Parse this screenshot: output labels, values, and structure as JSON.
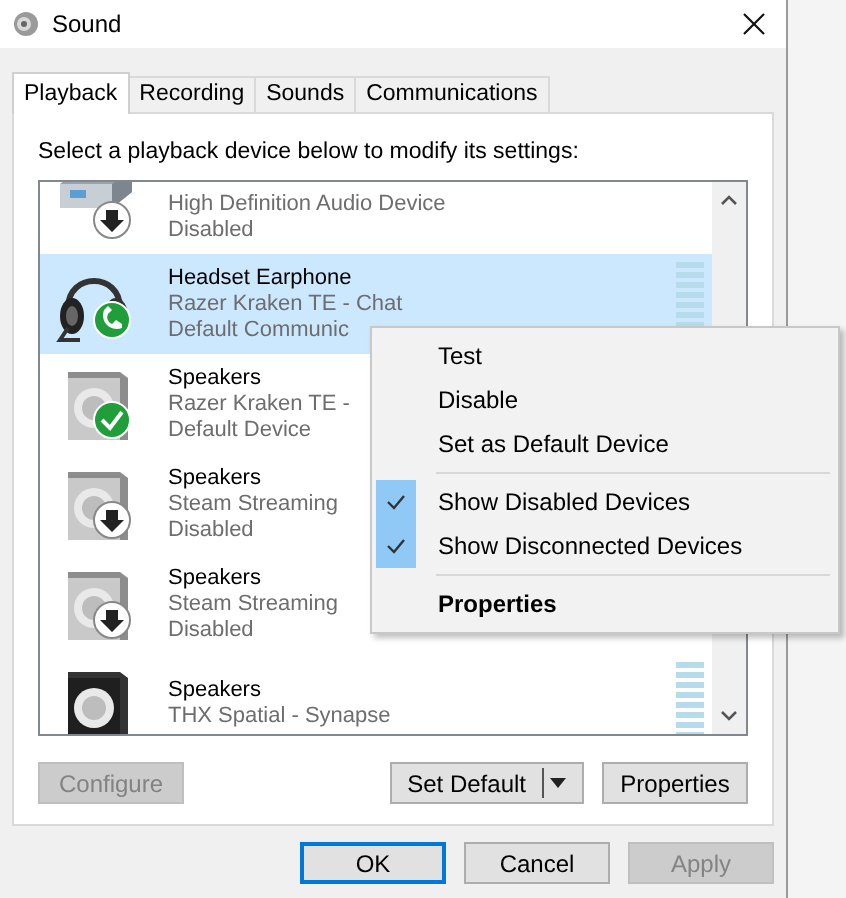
{
  "window": {
    "title": "Sound"
  },
  "tabs": [
    {
      "label": "Playback",
      "selected": true
    },
    {
      "label": "Recording",
      "selected": false
    },
    {
      "label": "Sounds",
      "selected": false
    },
    {
      "label": "Communications",
      "selected": false
    }
  ],
  "instruction": "Select a playback device below to modify its settings:",
  "devices": [
    {
      "kind": "card",
      "lines": [
        "High Definition Audio Device",
        "Disabled"
      ],
      "selected": false
    },
    {
      "kind": "headset",
      "name": "Headset Earphone",
      "lines": [
        "Razer Kraken TE - Chat",
        "Default Communic"
      ],
      "selected": true,
      "level": 0
    },
    {
      "kind": "default",
      "name": "Speakers",
      "lines": [
        "Razer Kraken TE -",
        "Default Device"
      ],
      "selected": false
    },
    {
      "kind": "disabled",
      "name": "Speakers",
      "lines": [
        "Steam Streaming",
        "Disabled"
      ],
      "selected": false
    },
    {
      "kind": "disabled",
      "name": "Speakers",
      "lines": [
        "Steam Streaming",
        "Disabled"
      ],
      "selected": false
    },
    {
      "kind": "thx",
      "name": "Speakers",
      "lines": [
        "THX Spatial - Synapse"
      ],
      "selected": false,
      "level": 0
    }
  ],
  "buttons": [
    {
      "label": "Configure",
      "disabled": true
    },
    {
      "label": "Set Default",
      "disabled": false,
      "split": true
    },
    {
      "label": "Properties",
      "disabled": false
    }
  ],
  "footer": [
    {
      "label": "OK",
      "disabled": false,
      "focused": true
    },
    {
      "label": "Cancel",
      "disabled": false,
      "focused": false
    },
    {
      "label": "Apply",
      "disabled": true,
      "focused": false
    }
  ],
  "context_menu": [
    {
      "kind": "item",
      "label": "Test",
      "checked": false,
      "bold": false
    },
    {
      "kind": "item",
      "label": "Disable",
      "checked": false,
      "bold": false
    },
    {
      "kind": "item",
      "label": "Set as Default Device",
      "checked": false,
      "bold": false
    },
    {
      "kind": "separator"
    },
    {
      "kind": "item",
      "label": "Show Disabled Devices",
      "checked": true,
      "bold": false
    },
    {
      "kind": "item",
      "label": "Show Disconnected Devices",
      "checked": true,
      "bold": false
    },
    {
      "kind": "separator"
    },
    {
      "kind": "item",
      "label": "Properties",
      "checked": false,
      "bold": true
    }
  ]
}
